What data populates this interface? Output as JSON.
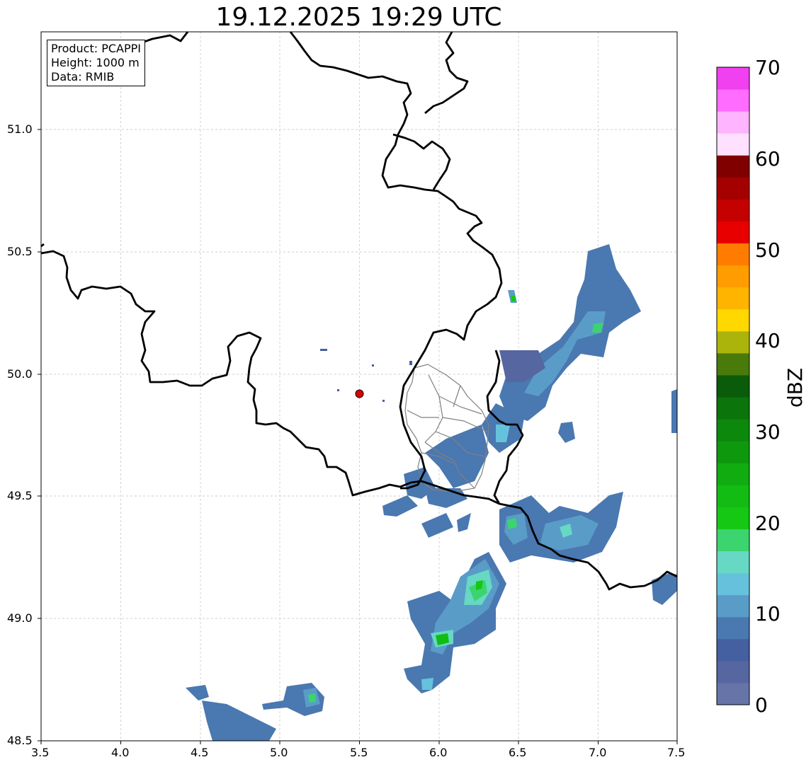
{
  "title": "19.12.2025 19:29 UTC",
  "info_box": {
    "product": "Product: PCAPPI",
    "height": "Height: 1000 m",
    "data": "Data: RMIB"
  },
  "axes": {
    "x_ticks": [
      "3.5",
      "4.0",
      "4.5",
      "5.0",
      "5.5",
      "6.0",
      "6.5",
      "7.0",
      "7.5"
    ],
    "y_ticks": [
      "51.0",
      "50.5",
      "50.0",
      "49.5",
      "49.0",
      "48.5"
    ],
    "x_range": [
      3.5,
      7.5
    ],
    "y_range": [
      48.5,
      51.4
    ],
    "grid": true
  },
  "radar_site": {
    "lon": 5.505,
    "lat": 49.915,
    "color": "#e00000"
  },
  "colorbar": {
    "label": "dBZ",
    "range": [
      0,
      70
    ],
    "tick_labels": [
      "0",
      "10",
      "20",
      "30",
      "40",
      "50",
      "60",
      "70"
    ],
    "colors": [
      "#6674a8",
      "#5566a0",
      "#4460a0",
      "#4a78b0",
      "#5a9cc8",
      "#66c2dc",
      "#66d8c4",
      "#3cd46e",
      "#14c814",
      "#12bc12",
      "#10ac10",
      "#0e980e",
      "#0c880c",
      "#0b740b",
      "#0a5c0a",
      "#4a7a0a",
      "#aab40a",
      "#ffd800",
      "#ffb400",
      "#ff9c00",
      "#ff7c00",
      "#e80000",
      "#c40000",
      "#a40000",
      "#800000",
      "#ffe0ff",
      "#ffb4ff",
      "#ff6cff",
      "#f040f0"
    ]
  }
}
